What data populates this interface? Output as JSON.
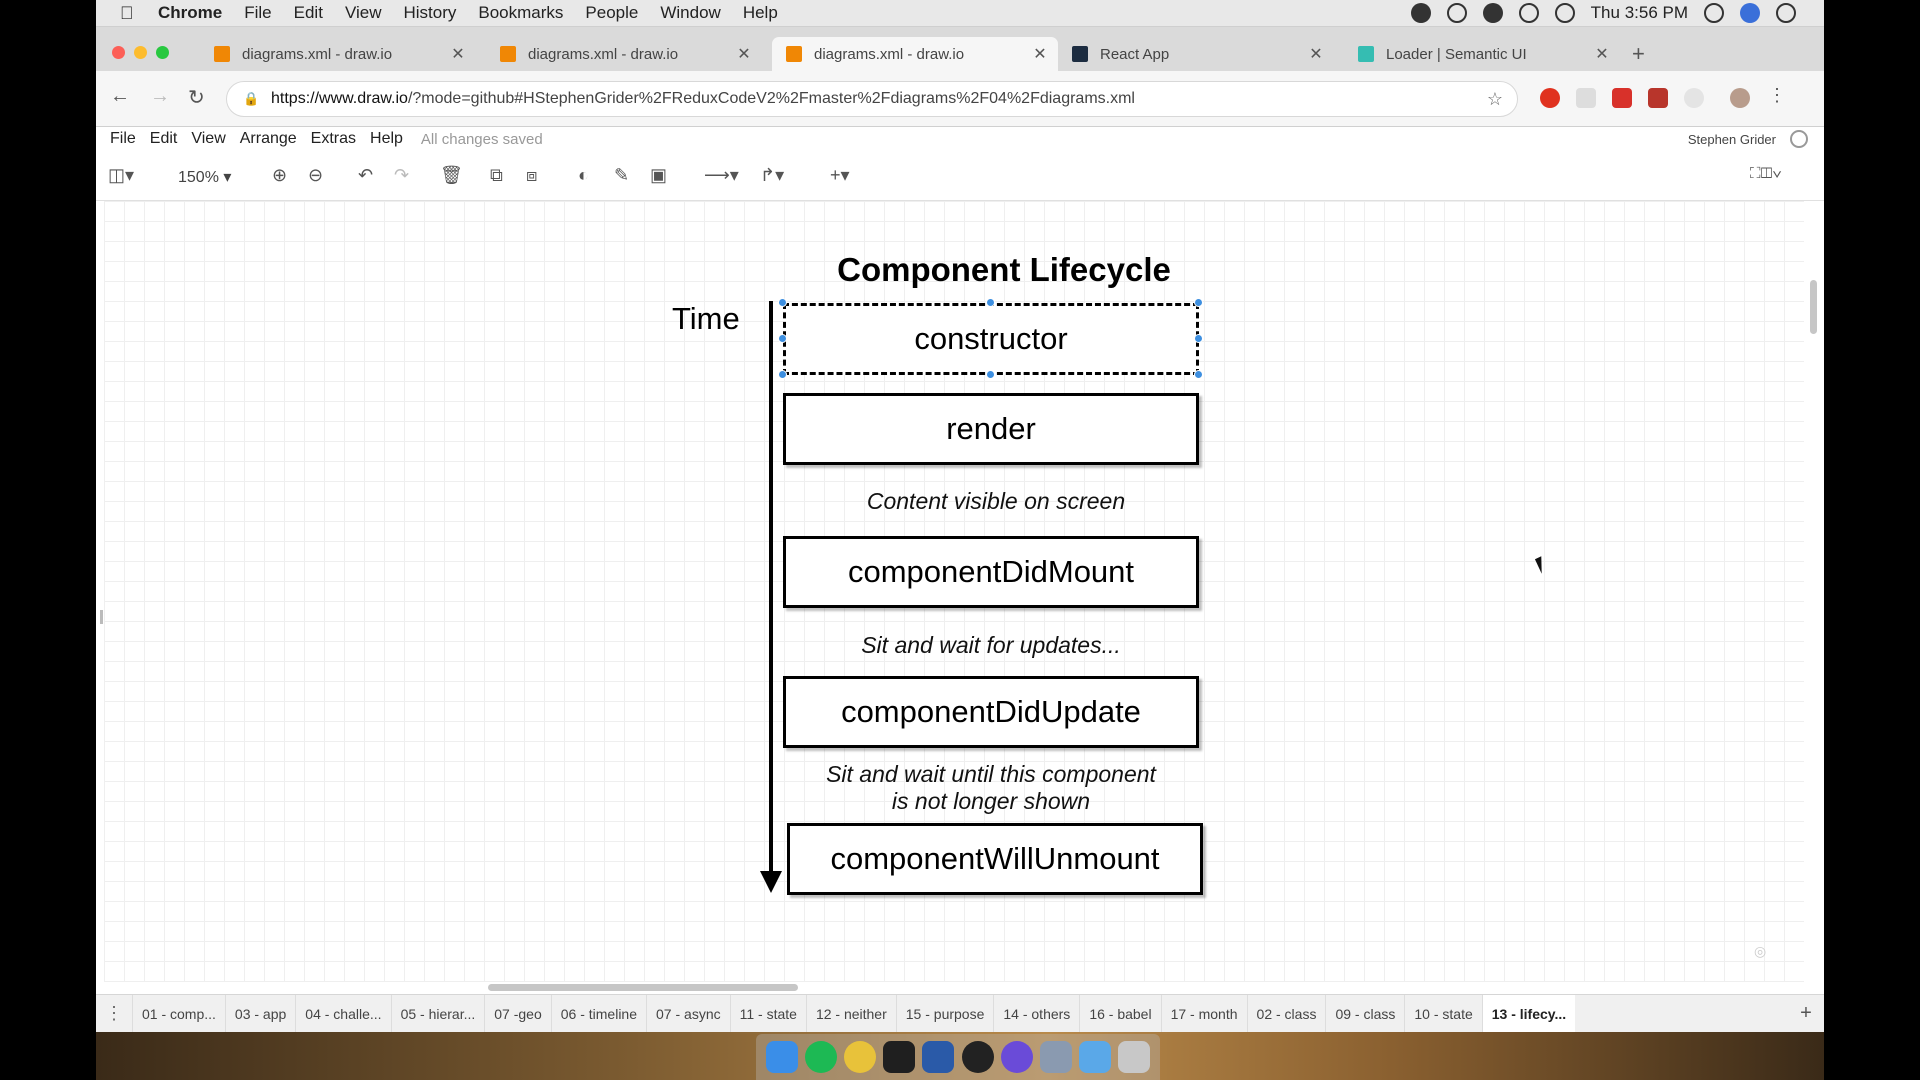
{
  "menubar": {
    "app": "Chrome",
    "items": [
      "File",
      "Edit",
      "View",
      "History",
      "Bookmarks",
      "People",
      "Window",
      "Help"
    ],
    "clock": "Thu 3:56 PM"
  },
  "tabs": [
    {
      "title": "diagrams.xml - draw.io",
      "favicon_color": "#f08705",
      "active": false
    },
    {
      "title": "diagrams.xml - draw.io",
      "favicon_color": "#f08705",
      "active": false
    },
    {
      "title": "diagrams.xml - draw.io",
      "favicon_color": "#f08705",
      "active": true
    },
    {
      "title": "React App",
      "favicon_color": "#1c2c40",
      "active": false
    },
    {
      "title": "Loader | Semantic UI",
      "favicon_color": "#35bdb2",
      "active": false
    }
  ],
  "address": {
    "url_host": "https://www.draw.io",
    "url_rest": "/?mode=github#HStephenGrider%2FReduxCodeV2%2Fmaster%2Fdiagrams%2F04%2Fdiagrams.xml"
  },
  "drawio_menu": {
    "items": [
      "File",
      "Edit",
      "View",
      "Arrange",
      "Extras",
      "Help"
    ],
    "status": "All changes saved",
    "user": "Stephen Grider"
  },
  "toolbar": {
    "zoom": "150%"
  },
  "diagram": {
    "title": "Component Lifecycle",
    "time_label": "Time",
    "boxes": {
      "constructor": "constructor",
      "render": "render",
      "did_mount": "componentDidMount",
      "did_update": "componentDidUpdate",
      "will_unmount": "componentWillUnmount"
    },
    "notes": {
      "visible": "Content visible on screen",
      "wait_updates": "Sit and wait for updates...",
      "wait_unmount_1": "Sit and wait until this component",
      "wait_unmount_2": "is not longer shown"
    }
  },
  "page_tabs": [
    "01 - comp...",
    "03 - app",
    "04 - challe...",
    "05 - hierar...",
    "07 -geo",
    "06 - timeline",
    "07 - async",
    "11 - state",
    "12 - neither",
    "15 - purpose",
    "14 - others",
    "16 - babel",
    "17 - month",
    "02 - class",
    "09 - class",
    "10 - state",
    "13 - lifecy..."
  ],
  "active_page_tab": "13 - lifecy...",
  "icons": {
    "back": "back-arrow-icon",
    "forward": "forward-arrow-icon",
    "reload": "reload-icon",
    "lock": "lock-icon",
    "star": "bookmark-star-icon"
  }
}
